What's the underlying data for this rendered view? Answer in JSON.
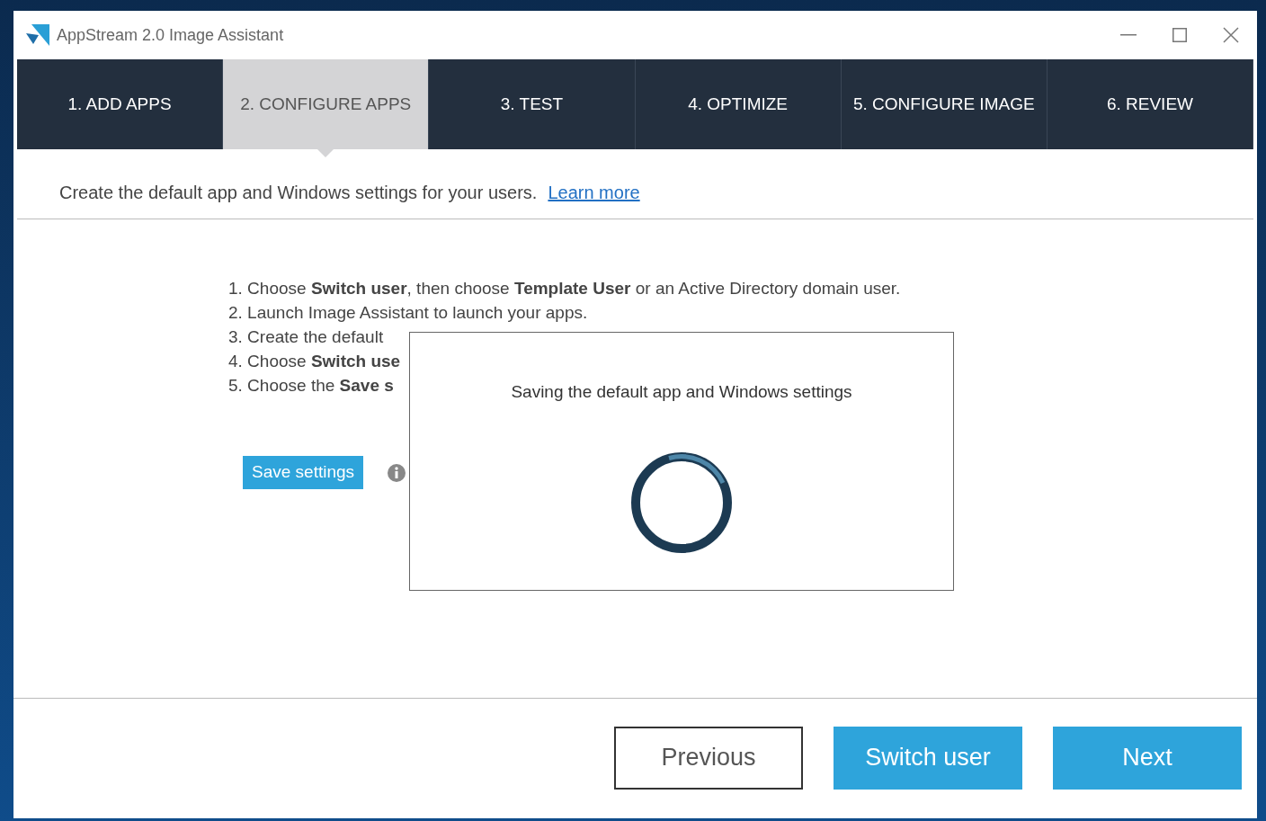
{
  "window": {
    "title": "AppStream 2.0 Image Assistant"
  },
  "tabs": [
    {
      "label": "1. ADD APPS",
      "selected": false
    },
    {
      "label": "2. CONFIGURE APPS",
      "selected": true
    },
    {
      "label": "3. TEST",
      "selected": false
    },
    {
      "label": "4. OPTIMIZE",
      "selected": false
    },
    {
      "label": "5. CONFIGURE IMAGE",
      "selected": false
    },
    {
      "label": "6. REVIEW",
      "selected": false
    }
  ],
  "intro": {
    "text": "Create the default app and Windows settings for your users.",
    "link": "Learn more"
  },
  "steps": [
    "1. Choose **Switch user**, then choose **Template User** or an Active Directory domain user.",
    "2. Launch Image Assistant to launch your apps.",
    "3. Create the default",
    "4. Choose **Switch use**",
    "5. Choose the **Save s**"
  ],
  "save_button": "Save settings",
  "dialog": {
    "message": "Saving the default app and Windows settings"
  },
  "footer_buttons": [
    {
      "label": "Previous",
      "kind": "secondary"
    },
    {
      "label": "Switch user",
      "kind": "primary"
    },
    {
      "label": "Next",
      "kind": "primary"
    }
  ]
}
